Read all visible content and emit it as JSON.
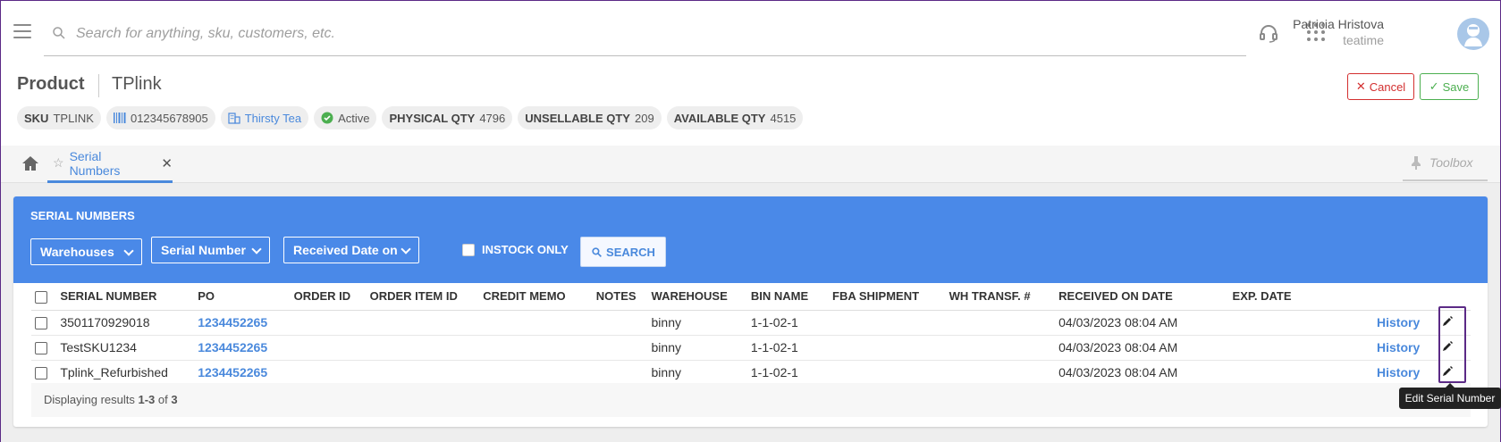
{
  "search": {
    "placeholder": "Search for anything, sku, customers, etc."
  },
  "user": {
    "name": "Patricia Hristova",
    "org": "teatime"
  },
  "header": {
    "title": "Product",
    "product_name": "TPlink",
    "cancel_label": "Cancel",
    "save_label": "Save"
  },
  "chips": {
    "sku_label": "SKU",
    "sku_value": "TPLINK",
    "barcode": "012345678905",
    "vendor": "Thirsty Tea",
    "status": "Active",
    "physical_label": "PHYSICAL QTY",
    "physical_value": "4796",
    "unsellable_label": "UNSELLABLE QTY",
    "unsellable_value": "209",
    "available_label": "AVAILABLE QTY",
    "available_value": "4515"
  },
  "tabs": {
    "active_label": "Serial Numbers",
    "toolbox_label": "Toolbox"
  },
  "panel": {
    "title": "SERIAL NUMBERS",
    "filters": {
      "warehouses": "Warehouses",
      "serial_number": "Serial Number",
      "received_date": "Received Date on",
      "instock_label": "INSTOCK ONLY",
      "search_label": "SEARCH"
    },
    "columns": [
      "SERIAL NUMBER",
      "PO",
      "ORDER ID",
      "ORDER ITEM ID",
      "CREDIT MEMO",
      "NOTES",
      "WAREHOUSE",
      "BIN NAME",
      "FBA SHIPMENT",
      "WH TRANSF. #",
      "RECEIVED ON DATE",
      "EXP. DATE"
    ],
    "rows": [
      {
        "serial": "3501170929018",
        "po": "1234452265",
        "warehouse": "binny",
        "bin": "1-1-02-1",
        "received": "04/03/2023 08:04 AM",
        "history": "History"
      },
      {
        "serial": "TestSKU1234",
        "po": "1234452265",
        "warehouse": "binny",
        "bin": "1-1-02-1",
        "received": "04/03/2023 08:04 AM",
        "history": "History"
      },
      {
        "serial": "Tplink_Refurbished",
        "po": "1234452265",
        "warehouse": "binny",
        "bin": "1-1-02-1",
        "received": "04/03/2023 08:04 AM",
        "history": "History"
      }
    ],
    "footer": {
      "prefix": "Displaying results ",
      "range": "1-3",
      "of": " of ",
      "total": "3"
    }
  },
  "tooltip": "Edit Serial Number",
  "colors": {
    "accent": "#4a89e8",
    "link": "#4a89dc",
    "cancel": "#d32f2f",
    "save": "#4caf50",
    "highlight": "#5b2a86"
  }
}
